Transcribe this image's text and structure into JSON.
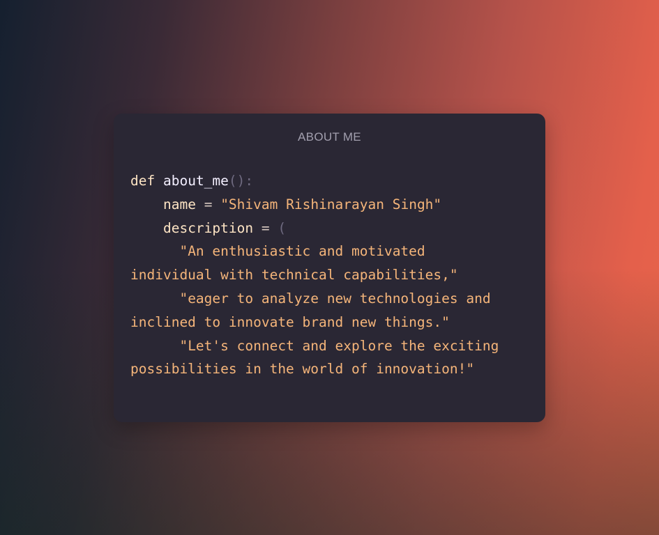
{
  "card": {
    "title": "ABOUT ME"
  },
  "code": {
    "keyword_def": "def",
    "function_name": "about_me",
    "function_parens": "()",
    "function_colon": ":",
    "name_var": "name",
    "assign_op": "=",
    "name_value": "\"Shivam Rishinarayan Singh\"",
    "description_var": "description",
    "open_paren": "(",
    "desc_line_1a": "\"An enthusiastic and motivated",
    "desc_line_1b": "individual with technical capabilities,\"",
    "desc_line_2a": "\"eager to analyze new technologies and",
    "desc_line_2b": "inclined to innovate brand new things.\"",
    "desc_line_3a": "\"Let's connect and explore the exciting",
    "desc_line_3b": "possibilities in the world of innovation!\""
  },
  "colors": {
    "card_background": "#2a2734",
    "string": "#f5b57a",
    "keyword": "#fde4c4",
    "function_name": "#f3efff",
    "punctuation": "#6f6a80",
    "title": "#a29fae",
    "gradient_left": "#15202f",
    "gradient_right": "#e8654a"
  }
}
